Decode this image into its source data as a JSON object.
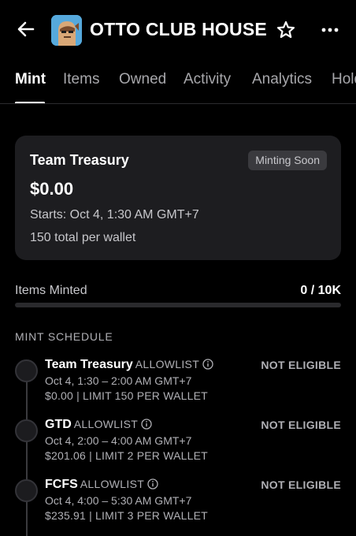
{
  "header": {
    "title": "OTTO CLUB HOUSE",
    "back_icon": "arrow-left-icon",
    "star_icon": "star-outline-icon",
    "more_icon": "ellipsis-icon"
  },
  "tabs": [
    {
      "label": "Mint",
      "active": true
    },
    {
      "label": "Items",
      "active": false
    },
    {
      "label": "Owned",
      "active": false
    },
    {
      "label": "Activity",
      "active": false
    },
    {
      "label": "Analytics",
      "active": false
    },
    {
      "label": "Holders",
      "active": false
    }
  ],
  "current_stage": {
    "title": "Team Treasury",
    "badge": "Minting Soon",
    "price": "$0.00",
    "starts": "Starts: Oct 4, 1:30 AM GMT+7",
    "limit": "150 total per wallet"
  },
  "minted": {
    "label": "Items Minted",
    "value": "0 / 10K",
    "progress_fraction": 0
  },
  "schedule": {
    "heading": "MINT SCHEDULE",
    "stages": [
      {
        "name": "Team Treasury",
        "type": "ALLOWLIST",
        "status": "NOT ELIGIBLE",
        "time": "Oct 4, 1:30 – 2:00 AM GMT+7",
        "price_limit": "$0.00 | LIMIT 150 PER WALLET"
      },
      {
        "name": "GTD",
        "type": "ALLOWLIST",
        "status": "NOT ELIGIBLE",
        "time": "Oct 4, 2:00 – 4:00 AM GMT+7",
        "price_limit": "$201.06 | LIMIT 2 PER WALLET"
      },
      {
        "name": "FCFS",
        "type": "ALLOWLIST",
        "status": "NOT ELIGIBLE",
        "time": "Oct 4, 4:00 – 5:30 AM GMT+7",
        "price_limit": "$235.91 | LIMIT 3 PER WALLET"
      }
    ]
  },
  "colors": {
    "background": "#000000",
    "card": "#1d1d20",
    "accent": "#2081e2",
    "muted_text": "#b0b0b5"
  }
}
